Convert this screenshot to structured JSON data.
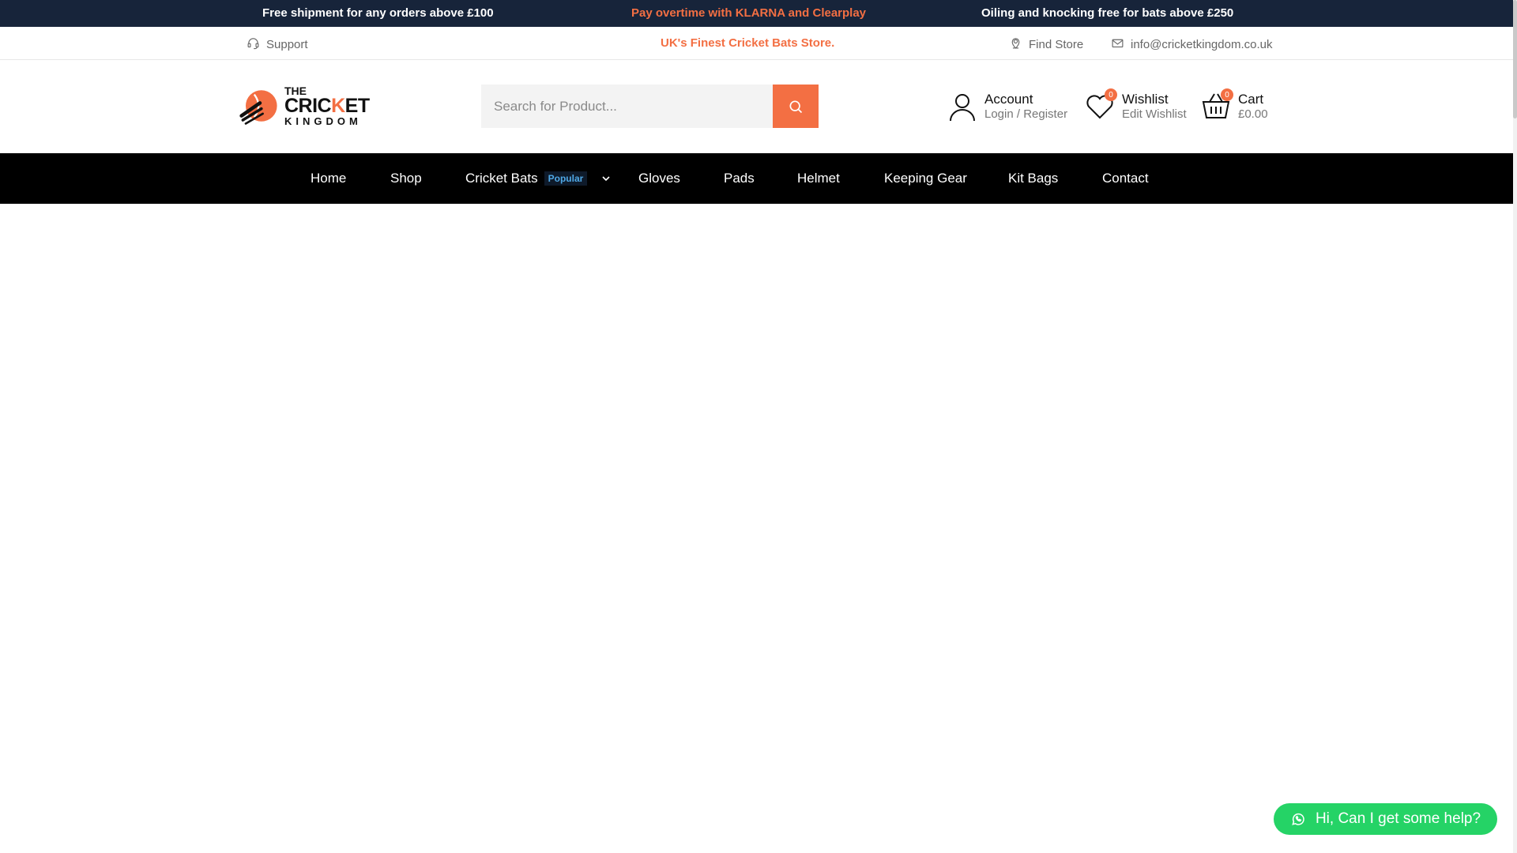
{
  "promo": {
    "left": "Free shipment for any orders above £100",
    "center": "Pay overtime with KLARNA and Clearplay",
    "right": "Oiling and knocking free for bats above £250"
  },
  "utility": {
    "support": "Support",
    "tagline": "UK's Finest Cricket Bats Store.",
    "find_store": "Find Store",
    "email": "info@cricketkingdom.co.uk"
  },
  "logo": {
    "line1": "THE",
    "line2a": "CRIC",
    "line2b": "K",
    "line2c": "ET",
    "line3": "KINGDOM"
  },
  "search": {
    "placeholder": "Search for Product..."
  },
  "account": {
    "title": "Account",
    "subtitle": "Login / Register"
  },
  "wishlist": {
    "title": "Wishlist",
    "subtitle": "Edit Wishlist",
    "count": "0"
  },
  "cart": {
    "title": "Cart",
    "subtitle": "£0.00",
    "count": "0"
  },
  "nav": {
    "items": [
      "Home",
      "Shop",
      "Cricket Bats",
      "Gloves",
      "Pads",
      "Helmet",
      "Keeping Gear",
      "Kit Bags",
      "Contact"
    ],
    "popular_badge": "Popular"
  },
  "help": {
    "label": "Hi, Can I get some help?"
  },
  "colors": {
    "accent": "#f36f43",
    "topbar": "#17243a",
    "nav_bg": "#000000",
    "whatsapp": "#25d366"
  }
}
